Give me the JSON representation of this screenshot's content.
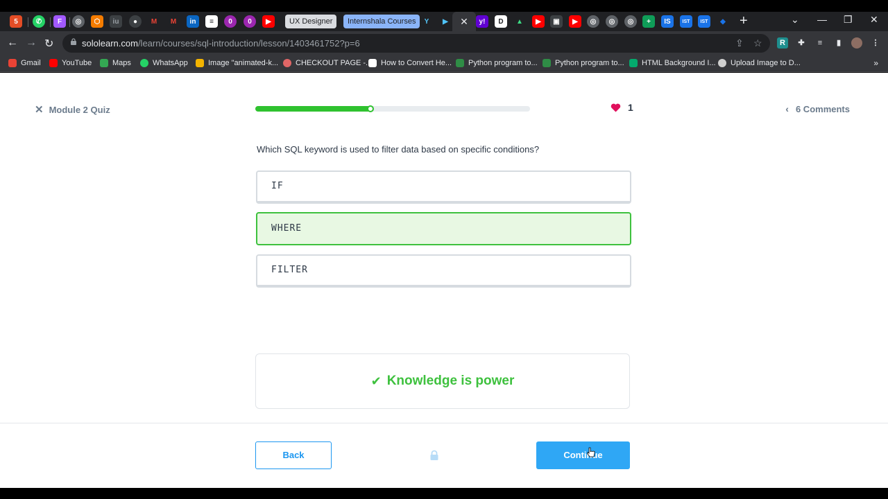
{
  "browser": {
    "tab_pills": [
      "UX Designer",
      "Internshala Courses"
    ],
    "url_host": "sololearn.com",
    "url_path": "/learn/courses/sql-introduction/lesson/1403461752?p=6",
    "bookmarks": [
      {
        "label": "Gmail",
        "color": "#ea4335"
      },
      {
        "label": "YouTube",
        "color": "#ff0000"
      },
      {
        "label": "Maps",
        "color": "#34a853"
      },
      {
        "label": "WhatsApp",
        "color": "#25d366"
      },
      {
        "label": "Image \"animated-k...",
        "color": "#f4b400"
      },
      {
        "label": "CHECKOUT PAGE -...",
        "color": "#e06666"
      },
      {
        "label": "How to Convert He...",
        "color": "#ffffff"
      },
      {
        "label": "Python program to...",
        "color": "#2f8d46"
      },
      {
        "label": "Python program to...",
        "color": "#2f8d46"
      },
      {
        "label": "HTML Background I...",
        "color": "#04aa6d"
      },
      {
        "label": "Upload Image to D...",
        "color": "#cfcfcf"
      }
    ]
  },
  "quiz": {
    "title": "Module 2 Quiz",
    "progress_fraction": 0.42,
    "lives": "1",
    "comments": "6 Comments",
    "question": "Which SQL keyword is used to filter data based on specific conditions?",
    "options": [
      {
        "label": "IF",
        "selected": false
      },
      {
        "label": "WHERE",
        "selected": true
      },
      {
        "label": "FILTER",
        "selected": false
      }
    ],
    "feedback": "Knowledge is power",
    "back_label": "Back",
    "continue_label": "Continue"
  },
  "colors": {
    "accent": "#2fa7f5",
    "success": "#3ec13e",
    "heart": "#e0105c"
  }
}
